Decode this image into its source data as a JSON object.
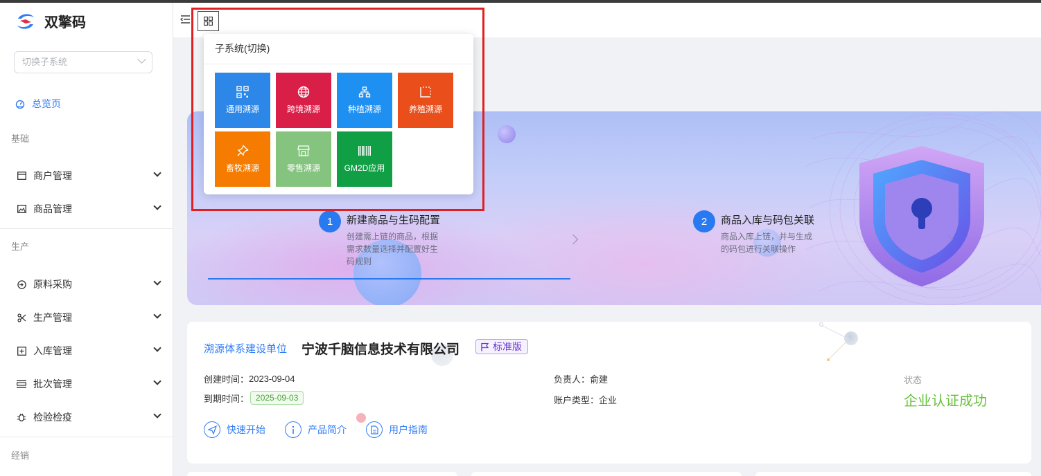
{
  "app": {
    "brand_name": "双擎码"
  },
  "sidebar": {
    "switch_placeholder": "切换子系统",
    "overview_label": "总览页",
    "groups": {
      "basic": "基础",
      "production": "生产",
      "sales": "经销"
    },
    "items": [
      {
        "label": "商户管理",
        "icon": "store-icon"
      },
      {
        "label": "商品管理",
        "icon": "image-icon"
      },
      {
        "label": "原料采购",
        "icon": "login-icon"
      },
      {
        "label": "生产管理",
        "icon": "scissors-icon"
      },
      {
        "label": "入库管理",
        "icon": "box-plus-icon"
      },
      {
        "label": "批次管理",
        "icon": "list-icon"
      },
      {
        "label": "检验检疫",
        "icon": "bug-icon"
      }
    ]
  },
  "popover": {
    "title": "子系统(切换)",
    "tiles": [
      {
        "label": "通用溯源",
        "color": "#2c87e8",
        "icon": "qrcode-icon"
      },
      {
        "label": "跨境溯源",
        "color": "#d91e48",
        "icon": "globe-icon"
      },
      {
        "label": "种植溯源",
        "color": "#1e90f2",
        "icon": "org-tree-icon"
      },
      {
        "label": "养殖溯源",
        "color": "#e94e1b",
        "icon": "crop-icon"
      },
      {
        "label": "畜牧溯源",
        "color": "#f57c00",
        "icon": "pin-icon"
      },
      {
        "label": "零售溯源",
        "color": "#85c47f",
        "icon": "shop-icon"
      },
      {
        "label": "GM2D应用",
        "color": "#109f45",
        "icon": "barcode-icon"
      }
    ]
  },
  "banner": {
    "steps": [
      {
        "num": "1",
        "title": "新建商品与生码配置",
        "desc": "创建需上链的商品，根据需求数量选择并配置好生码规则"
      },
      {
        "num": "2",
        "title": "商品入库与码包关联",
        "desc": "商品入库上链，并与生成的码包进行关联操作"
      }
    ]
  },
  "company": {
    "unit_label": "溯源体系建设单位",
    "name": "宁波千脑信息技术有限公司",
    "edition": "标准版",
    "created_label": "创建时间：",
    "created_value": "2023-09-04",
    "expire_label": "到期时间：",
    "expire_value": "2025-09-03",
    "owner_label": "负责人：",
    "owner_value": "俞建",
    "account_label": "账户类型：",
    "account_value": "企业",
    "status_label": "状态",
    "status_value": "企业认证成功",
    "links": [
      {
        "label": "快速开始",
        "icon": "send-icon"
      },
      {
        "label": "产品简介",
        "icon": "info-icon"
      },
      {
        "label": "用户指南",
        "icon": "doc-icon"
      }
    ]
  },
  "colors": {
    "accent": "#2f7cf6",
    "success": "#67c23a",
    "highlight": "#e02020"
  }
}
